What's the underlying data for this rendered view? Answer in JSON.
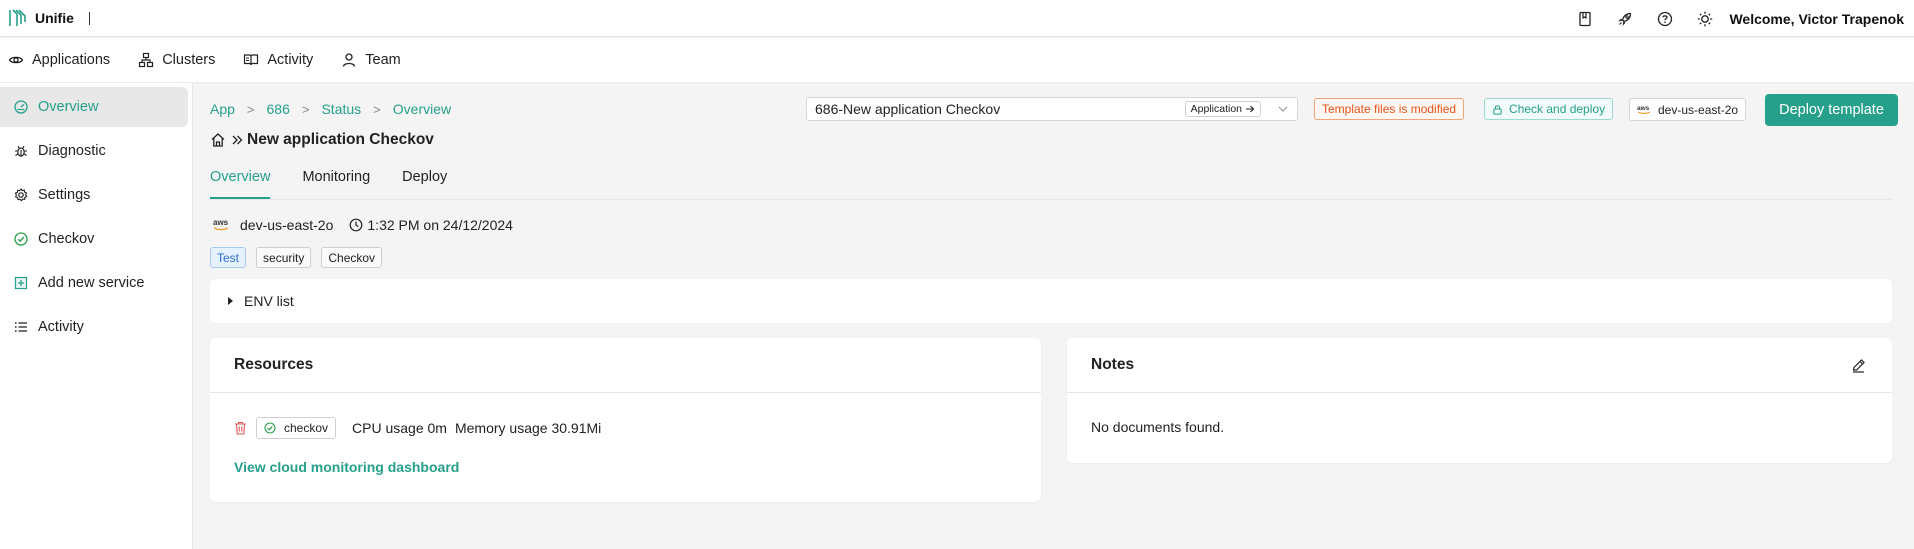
{
  "app": {
    "name": "Unifie",
    "welcome": "Welcome, Victor Trapenok"
  },
  "topbar": {
    "icons": [
      "book-icon",
      "rocket-icon",
      "help-icon",
      "sun-icon"
    ]
  },
  "mainnav": {
    "items": [
      {
        "label": "Applications",
        "icon": "eye-icon"
      },
      {
        "label": "Clusters",
        "icon": "cluster-icon"
      },
      {
        "label": "Activity",
        "icon": "book-open-icon"
      },
      {
        "label": "Team",
        "icon": "user-icon"
      }
    ]
  },
  "sidebar": {
    "items": [
      {
        "label": "Overview",
        "icon": "dashboard-icon",
        "active": true
      },
      {
        "label": "Diagnostic",
        "icon": "bug-icon"
      },
      {
        "label": "Settings",
        "icon": "gear-icon"
      },
      {
        "label": "Checkov",
        "icon": "check-circle-icon"
      },
      {
        "label": "Add new service",
        "icon": "plus-square-icon"
      },
      {
        "label": "Activity",
        "icon": "list-icon"
      }
    ]
  },
  "breadcrumb": [
    "App",
    "686",
    "Status",
    "Overview"
  ],
  "app_select": {
    "value": "686-New application Checkov",
    "chip": "Application"
  },
  "status": {
    "modified": "Template files is modified",
    "check_deploy": "Check and deploy",
    "region": "dev-us-east-2o",
    "deploy_button": "Deploy template"
  },
  "page": {
    "title": "New application Checkov"
  },
  "tabs": [
    {
      "label": "Overview",
      "active": true
    },
    {
      "label": "Monitoring"
    },
    {
      "label": "Deploy"
    }
  ],
  "meta": {
    "cluster": "dev-us-east-2o",
    "time": "1:32 PM on 24/12/2024"
  },
  "tags": [
    {
      "label": "Test",
      "highlighted": true
    },
    {
      "label": "security"
    },
    {
      "label": "Checkov"
    }
  ],
  "env": {
    "label": "ENV list"
  },
  "resources": {
    "title": "Resources",
    "service": "checkov",
    "cpu": "CPU usage 0m",
    "memory": "Memory usage 30.91Mi",
    "link": "View cloud monitoring dashboard"
  },
  "notes": {
    "title": "Notes",
    "empty": "No documents found."
  },
  "colors": {
    "accent": "#26a08b",
    "warning": "#e2541e",
    "danger": "#e05555"
  }
}
